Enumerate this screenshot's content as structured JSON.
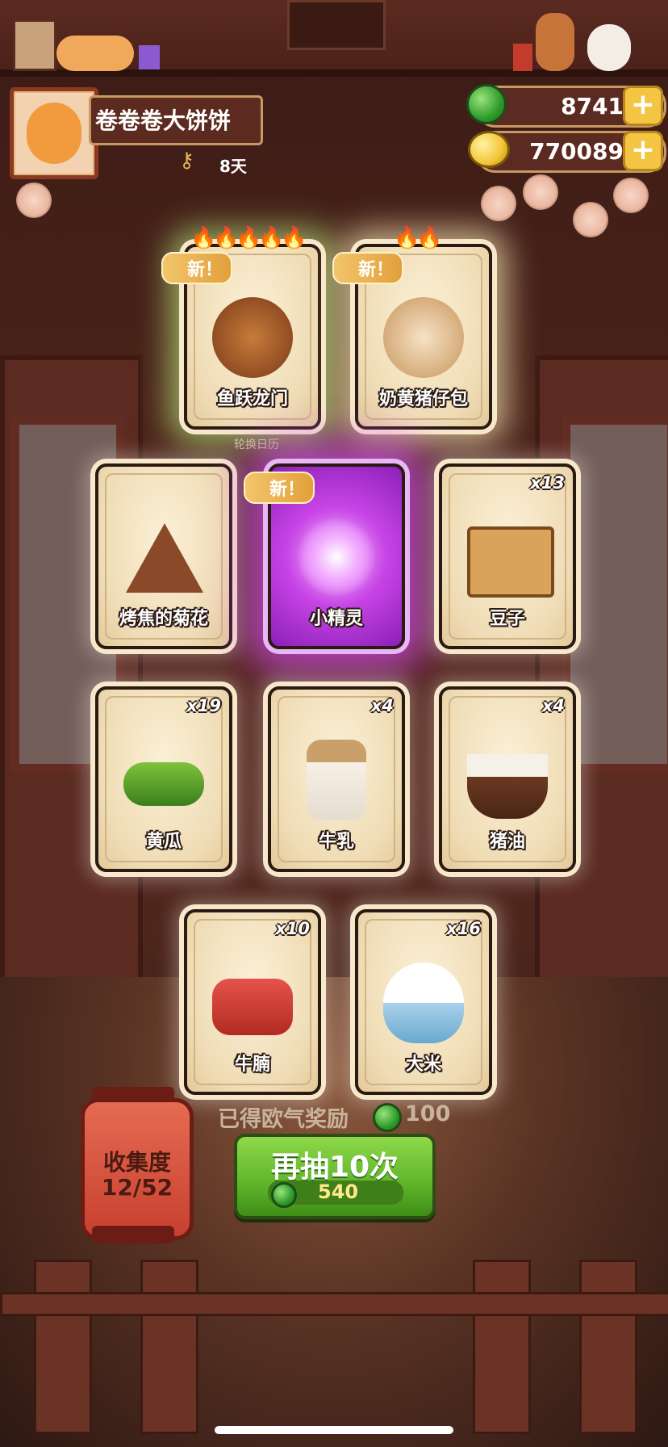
{
  "player": {
    "name": "卷卷卷大饼饼",
    "days": "8天"
  },
  "currency": {
    "jade": "8741",
    "coins": "770089"
  },
  "labels": {
    "new_tag": "新！",
    "rotate_calendar": "轮换日历"
  },
  "cards": [
    {
      "name": "鱼跃龙门",
      "count": "",
      "is_new": true,
      "flames": 5,
      "art": "dragon-fish-dish-icon"
    },
    {
      "name": "奶黄猪仔包",
      "count": "",
      "is_new": true,
      "flames": 2,
      "art": "steamed-buns-icon"
    },
    {
      "name": "烤焦的菊花",
      "count": "",
      "is_new": false,
      "flames": 0,
      "art": "burnt-cookie-icon"
    },
    {
      "name": "小精灵",
      "count": "",
      "is_new": true,
      "flames": 0,
      "art": "sparkle-spirit-icon"
    },
    {
      "name": "豆子",
      "count": "x13",
      "is_new": false,
      "flames": 0,
      "art": "bean-box-icon"
    },
    {
      "name": "黄瓜",
      "count": "x19",
      "is_new": false,
      "flames": 0,
      "art": "cucumber-icon"
    },
    {
      "name": "牛乳",
      "count": "x4",
      "is_new": false,
      "flames": 0,
      "art": "milk-jar-icon"
    },
    {
      "name": "猪油",
      "count": "x4",
      "is_new": false,
      "flames": 0,
      "art": "lard-bowl-icon"
    },
    {
      "name": "牛腩",
      "count": "x10",
      "is_new": false,
      "flames": 0,
      "art": "beef-brisket-icon"
    },
    {
      "name": "大米",
      "count": "x16",
      "is_new": false,
      "flames": 0,
      "art": "rice-bowl-icon"
    }
  ],
  "reward": {
    "label": "已得欧气奖励",
    "value": "100"
  },
  "draw_button": {
    "label": "再抽10次",
    "cost": "540"
  },
  "collection": {
    "label": "收集度",
    "progress": "12/52"
  }
}
